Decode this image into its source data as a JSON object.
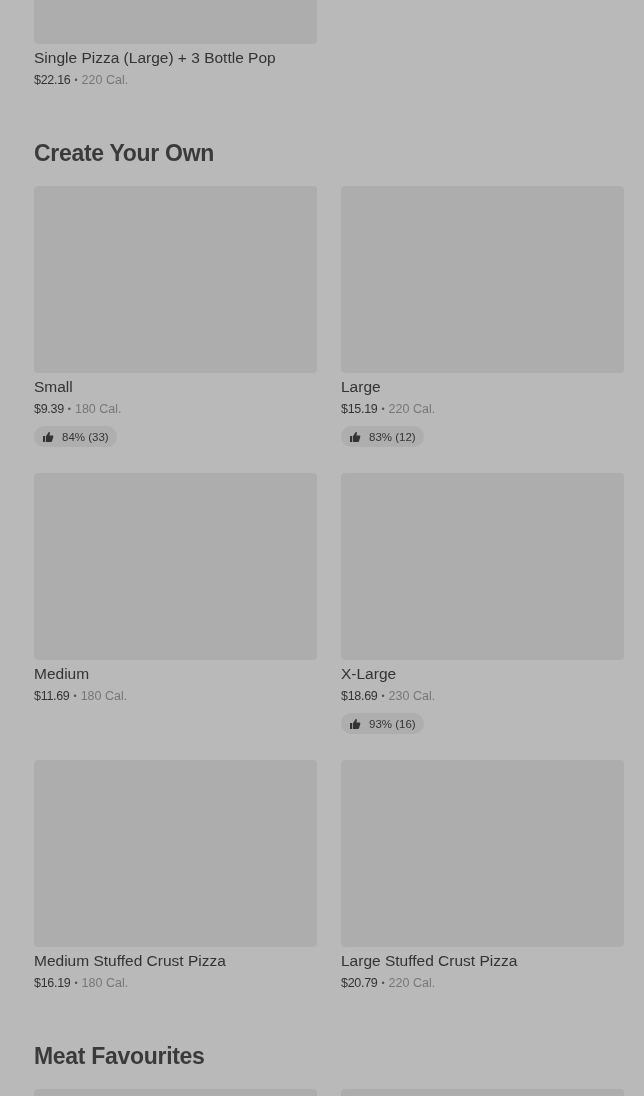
{
  "sections": [
    {
      "kind": "continued",
      "items": [
        {
          "kind": "dish",
          "name": "Single Pizza (Large) + 3 Bottle Pop",
          "price": "$22.16",
          "separator": "•",
          "calories": "220 Cal."
        }
      ]
    },
    {
      "kind": "full",
      "title": "Create Your Own",
      "items": [
        {
          "kind": "dish",
          "name": "Small",
          "price": "$9.39",
          "separator": "•",
          "calories": "180 Cal.",
          "rating": "84% (33)"
        },
        {
          "kind": "dish",
          "name": "Large",
          "price": "$15.19",
          "separator": "•",
          "calories": "220 Cal.",
          "rating": "83% (12)"
        },
        {
          "kind": "dish",
          "name": "Medium",
          "price": "$11.69",
          "separator": "•",
          "calories": "180 Cal."
        },
        {
          "kind": "dish",
          "name": "X-Large",
          "price": "$18.69",
          "separator": "•",
          "calories": "230 Cal.",
          "rating": "93% (16)"
        },
        {
          "kind": "dish",
          "name": "Medium Stuffed Crust Pizza",
          "price": "$16.19",
          "separator": "•",
          "calories": "180 Cal."
        },
        {
          "kind": "dish",
          "name": "Large Stuffed Crust Pizza",
          "price": "$20.79",
          "separator": "•",
          "calories": "220 Cal."
        }
      ]
    },
    {
      "kind": "full",
      "title": "Meat Favourites",
      "items": [
        {
          "kind": "image-only"
        },
        {
          "kind": "image-only"
        }
      ]
    }
  ]
}
